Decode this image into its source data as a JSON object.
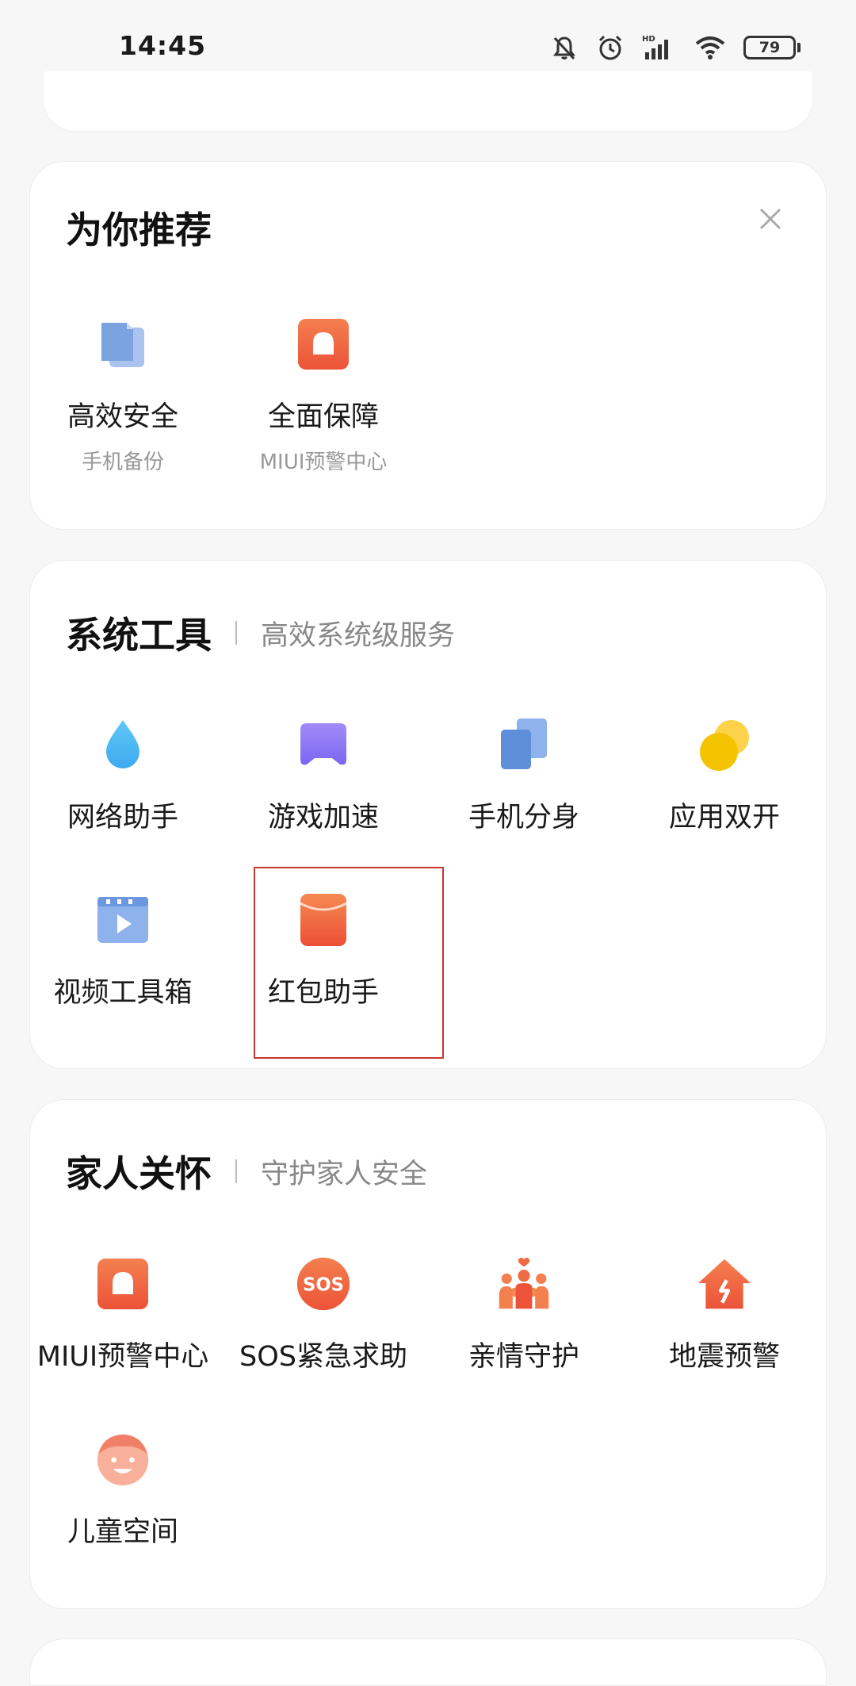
{
  "status": {
    "time": "14:45",
    "battery": "79",
    "network_label": "HD"
  },
  "recommend": {
    "title": "为你推荐",
    "items": [
      {
        "label": "高效安全",
        "sublabel": "手机备份",
        "icon": "backup-icon"
      },
      {
        "label": "全面保障",
        "sublabel": "MIUI预警中心",
        "icon": "alert-icon"
      }
    ]
  },
  "system_tools": {
    "title": "系统工具",
    "subtitle": "高效系统级服务",
    "items": [
      {
        "label": "网络助手",
        "icon": "water-drop-icon"
      },
      {
        "label": "游戏加速",
        "icon": "gamepad-icon"
      },
      {
        "label": "手机分身",
        "icon": "phone-clone-icon"
      },
      {
        "label": "应用双开",
        "icon": "dual-app-icon"
      },
      {
        "label": "视频工具箱",
        "icon": "video-toolbox-icon"
      },
      {
        "label": "红包助手",
        "icon": "red-envelope-icon"
      }
    ]
  },
  "family_care": {
    "title": "家人关怀",
    "subtitle": "守护家人安全",
    "items": [
      {
        "label": "MIUI预警中心",
        "icon": "alert-icon"
      },
      {
        "label": "SOS紧急求助",
        "icon": "sos-icon",
        "badge": "SOS"
      },
      {
        "label": "亲情守护",
        "icon": "family-icon"
      },
      {
        "label": "地震预警",
        "icon": "earthquake-icon"
      },
      {
        "label": "儿童空间",
        "icon": "kid-face-icon"
      }
    ]
  },
  "colors": {
    "accent_orange": "#f06a43",
    "highlight_red": "#c8352e",
    "blue": "#7aa3e0",
    "purple": "#8e7cf6",
    "yellow": "#f7c600"
  }
}
